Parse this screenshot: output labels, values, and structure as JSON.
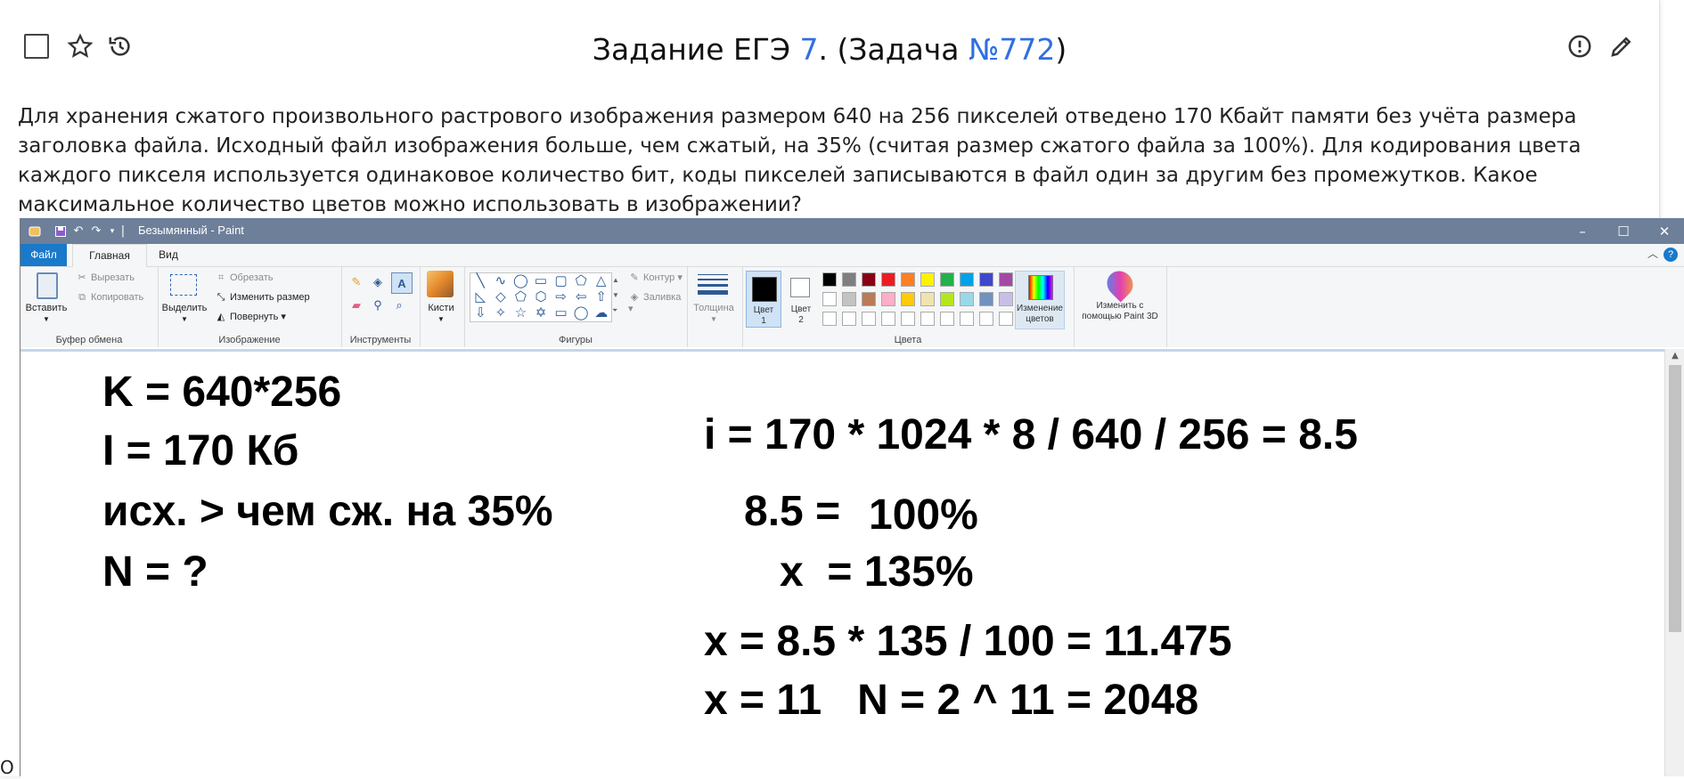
{
  "task": {
    "title_prefix": "Задание ЕГЭ ",
    "exam_number": "7",
    "title_middle": ". (Задача ",
    "problem_link": "№772",
    "title_suffix": ")",
    "text": "Для хранения сжатого произвольного растрового изображения размером 640 на 256 пикселей отведено 170 Кбайт памяти без учёта размера заголовка файла. Исходный файл изображения больше, чем сжатый, на 35% (считая размер сжатого файла за 100%). Для кодирования цвета каждого пикселя используется одинаковое количество бит, коды пикселей записываются в файл один за другим без промежутков. Какое максимальное количество цветов можно использовать в изображении?",
    "edge_glyph": "О"
  },
  "icons": {
    "checkbox": "checkbox-icon",
    "star": "star-icon",
    "history": "history-icon",
    "report": "report-icon",
    "edit": "pencil-icon"
  },
  "paint": {
    "window_title": "Безымянный - Paint",
    "tabs": {
      "file": "Файл",
      "home": "Главная",
      "view": "Вид"
    },
    "clipboard": {
      "paste": "Вставить",
      "cut": "Вырезать",
      "copy": "Копировать",
      "group": "Буфер обмена"
    },
    "image": {
      "select": "Выделить",
      "crop": "Обрезать",
      "resize": "Изменить размер",
      "rotate": "Повернуть",
      "group": "Изображение"
    },
    "tools": {
      "group": "Инструменты"
    },
    "brushes": {
      "label": "Кисти"
    },
    "shapes": {
      "outline": "Контур",
      "fill": "Заливка",
      "group": "Фигуры"
    },
    "size": {
      "label": "Толщина"
    },
    "colors": {
      "color1": "Цвет",
      "color1_num": "1",
      "color2": "Цвет",
      "color2_num": "2",
      "edit_line1": "Изменение",
      "edit_line2": "цветов",
      "group": "Цвета",
      "palette": [
        "#000000",
        "#7f7f7f",
        "#880015",
        "#ed1c24",
        "#ff7f27",
        "#fff200",
        "#22b14c",
        "#00a2e8",
        "#3f48cc",
        "#a349a4",
        "#ffffff",
        "#c3c3c3",
        "#b97a57",
        "#ffaec9",
        "#ffc90e",
        "#efe4b0",
        "#b5e61d",
        "#99d9ea",
        "#7092be",
        "#c8bfe7",
        "#ffffff",
        "#ffffff",
        "#ffffff",
        "#ffffff",
        "#ffffff",
        "#ffffff",
        "#ffffff",
        "#ffffff",
        "#ffffff",
        "#ffffff"
      ]
    },
    "paint3d": {
      "line1": "Изменить с",
      "line2": "помощью Paint 3D"
    },
    "window_buttons": {
      "min": "–",
      "max": "☐",
      "close": "✕"
    },
    "canvas_lines": {
      "l1": "K = 640*256",
      "l2": "I = 170 Кб",
      "l3": "исх. > чем сж. на 35%",
      "l4": "N = ?",
      "r1": "i = 170 * 1024 * 8 / 640 / 256 = 8.5",
      "r2a": "8.5 =",
      "r2b": "100%",
      "r3": "x  = 135%",
      "r4": "x = 8.5 * 135 / 100 = 11.475",
      "r5": "x = 11   N = 2 ^ 11 = 2048"
    }
  }
}
